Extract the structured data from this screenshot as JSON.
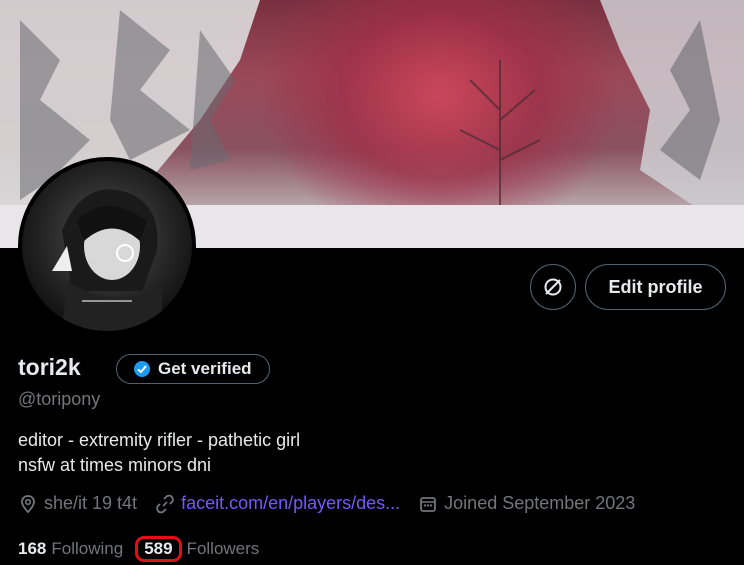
{
  "profile": {
    "display_name": "tori2k",
    "verify_label": "Get verified",
    "handle": "@toripony",
    "bio_line1": "editor - extremity rifler - pathetic girl",
    "bio_line2": "nsfw at times minors dni",
    "location": "she/it 19 t4t",
    "website": "faceit.com/en/players/des...",
    "joined": "Joined September 2023"
  },
  "actions": {
    "edit_label": "Edit profile"
  },
  "stats": {
    "following_count": "168",
    "following_label": "Following",
    "followers_count": "589",
    "followers_label": "Followers"
  },
  "icons": {
    "more": "sync-icon",
    "verified": "verified-badge-icon",
    "location": "location-pin-icon",
    "link": "link-icon",
    "calendar": "calendar-icon"
  },
  "colors": {
    "background": "#000000",
    "text": "#e7e9ea",
    "muted": "#71767b",
    "link": "#7856ff",
    "verified": "#1d9bf0",
    "highlight": "#e0101a",
    "border": "#536471"
  }
}
